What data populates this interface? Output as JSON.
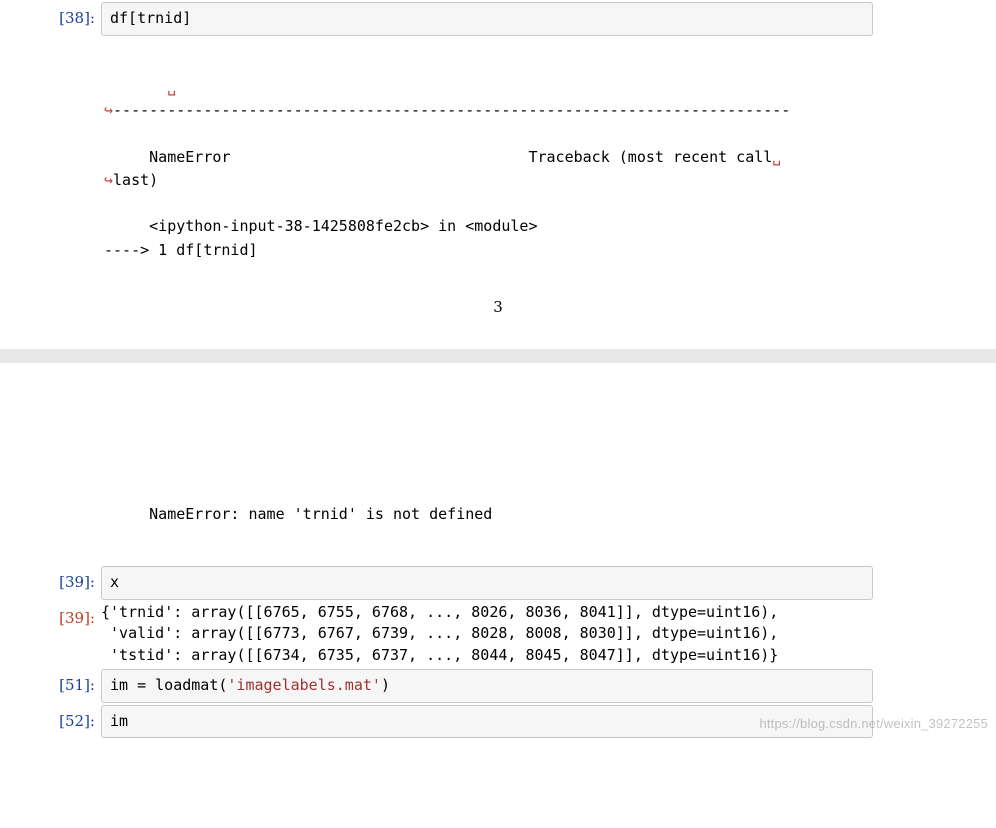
{
  "cells": {
    "c38": {
      "prompt": "[38]:",
      "code": "df[trnid]"
    },
    "c39in": {
      "prompt": "[39]:",
      "code": "x"
    },
    "c39out": {
      "prompt": "[39]:",
      "text": "{'trnid': array([[6765, 6755, 6768, ..., 8026, 8036, 8041]], dtype=uint16),\n 'valid': array([[6773, 6767, 6739, ..., 8028, 8008, 8030]], dtype=uint16),\n 'tstid': array([[6734, 6735, 6737, ..., 8044, 8045, 8047]], dtype=uint16)}"
    },
    "c51": {
      "prompt": "[51]:",
      "code_prefix": "im = loadmat(",
      "code_str": "'imagelabels.mat'",
      "code_suffix": ")"
    },
    "c52": {
      "prompt": "[52]:",
      "code": "im"
    }
  },
  "error38": {
    "cont": "␣",
    "arrow": "↪",
    "dashes": "---------------------------------------------------------------------------",
    "name_error": "     NameError",
    "traceback_prefix": "                                 Traceback (most recent call",
    "last": "last)",
    "ipython_line": "     <ipython-input-38-1425808fe2cb> in <module>",
    "arrow_line": "----> 1 df[trnid]",
    "final": "     NameError: name 'trnid' is not defined"
  },
  "page_number": "3",
  "watermark": "https://blog.csdn.net/weixin_39272255"
}
